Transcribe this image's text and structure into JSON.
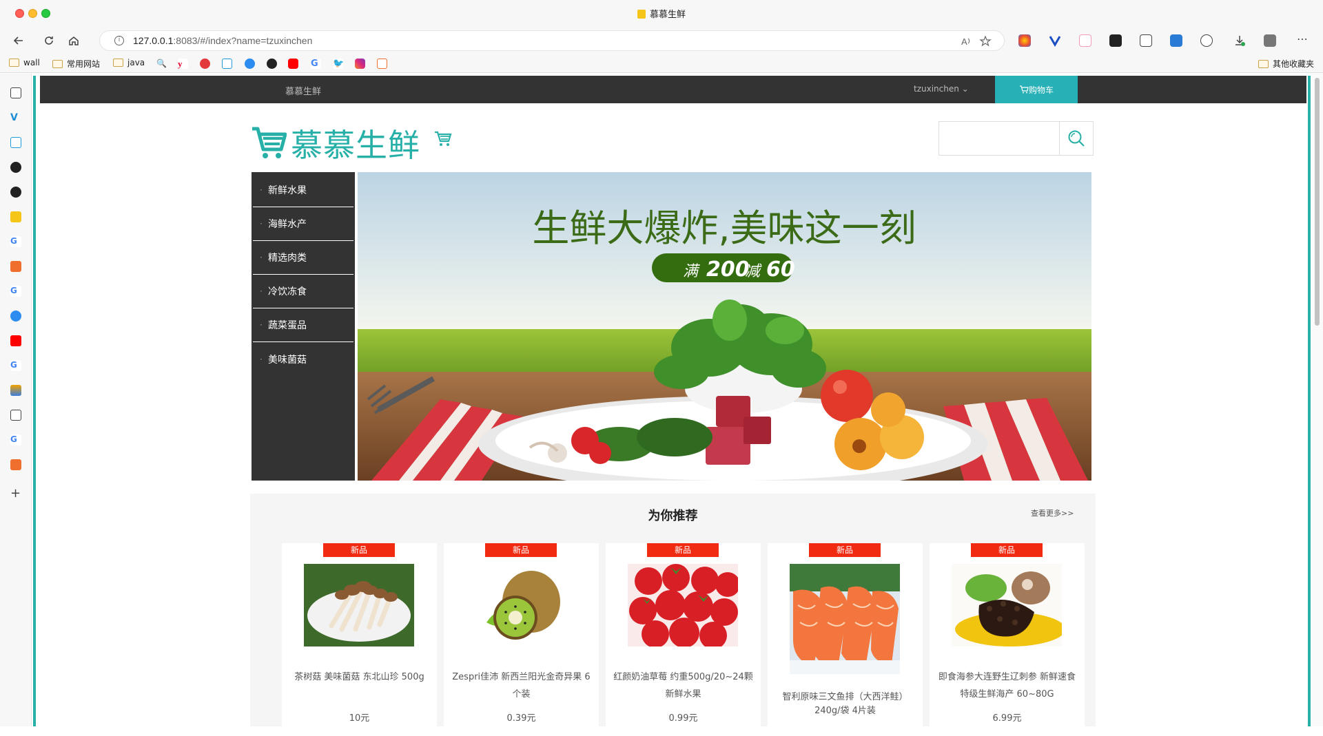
{
  "window": {
    "title": "慕慕生鲜"
  },
  "browser": {
    "url_host": "127.0.0.1",
    "url_rest": ":8083/#/index?name=tzuxinchen",
    "bookmarks": [
      {
        "label": "wall",
        "type": "folder"
      },
      {
        "label": "常用网站",
        "type": "folder"
      },
      {
        "label": "java",
        "type": "folder"
      }
    ],
    "other_bookmarks": "其他收藏夹"
  },
  "site": {
    "top_nav": {
      "brand": "慕慕生鲜",
      "username": "tzuxinchen",
      "cart_label": "购物车"
    },
    "logo_text": "慕慕生鲜",
    "search": {
      "placeholder": ""
    },
    "categories": [
      "新鲜水果",
      "海鲜水产",
      "精选肉类",
      "冷饮冻食",
      "蔬菜蛋品",
      "美味菌菇"
    ],
    "banner": {
      "headline": "生鲜大爆炸,美味这一刻",
      "promo_prefix": "满",
      "promo_amount": "200",
      "promo_mid": "减",
      "promo_discount": "60"
    },
    "recommend": {
      "title": "为你推荐",
      "more_label": "查看更多>>",
      "products": [
        {
          "badge": "新品",
          "name": "茶树菇 美味菌菇 东北山珍 500g",
          "price": "10元",
          "image": "mushroom"
        },
        {
          "badge": "新品",
          "name": "Zespri佳沛 新西兰阳光金奇异果 6个装",
          "price": "0.39元",
          "image": "kiwi"
        },
        {
          "badge": "新品",
          "name": "红颜奶油草莓 约重500g/20~24颗 新鲜水果",
          "price": "0.99元",
          "image": "strawberry"
        },
        {
          "badge": "新品",
          "name": "智利原味三文鱼排（大西洋鲑）240g/袋 4片装",
          "price": "",
          "image": "salmon"
        },
        {
          "badge": "新品",
          "name": "即食海参大连野生辽刺参 新鲜速食 特级生鲜海产 60~80G",
          "price": "6.99元",
          "image": "sea-cucumber"
        }
      ]
    }
  },
  "colors": {
    "accent": "#27b0a8",
    "badge": "#f02b11",
    "nav": "#333333"
  }
}
